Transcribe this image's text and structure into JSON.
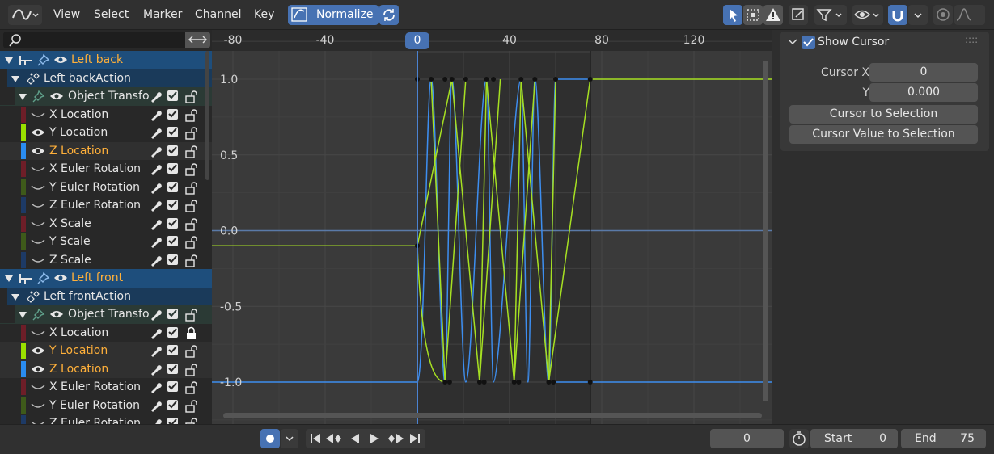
{
  "header": {
    "menus": [
      "View",
      "Select",
      "Marker",
      "Channel",
      "Key"
    ],
    "normalize_label": "Normalize"
  },
  "outliner": {
    "rows": [
      {
        "kind": "object",
        "label": "Left back"
      },
      {
        "kind": "action",
        "label": "Left backAction"
      },
      {
        "kind": "group",
        "label": "Object Transfor"
      },
      {
        "kind": "channel",
        "label": "X Location",
        "color": "#6e1e28",
        "eye": false,
        "lock": false
      },
      {
        "kind": "channel",
        "label": "Y Location",
        "color": "#9be000",
        "eye": true,
        "lock": false
      },
      {
        "kind": "channel",
        "label": "Z Location",
        "color": "#2a8cf0",
        "eye": true,
        "lock": false,
        "highlight": true
      },
      {
        "kind": "channel",
        "label": "X Euler Rotation",
        "color": "#6e1e28",
        "eye": false,
        "lock": false
      },
      {
        "kind": "channel",
        "label": "Y Euler Rotation",
        "color": "#3e5a1a",
        "eye": false,
        "lock": false
      },
      {
        "kind": "channel",
        "label": "Z Euler Rotation",
        "color": "#1d3a66",
        "eye": false,
        "lock": false
      },
      {
        "kind": "channel",
        "label": "X Scale",
        "color": "#6e1e28",
        "eye": false,
        "lock": false
      },
      {
        "kind": "channel",
        "label": "Y Scale",
        "color": "#3e5a1a",
        "eye": false,
        "lock": false
      },
      {
        "kind": "channel",
        "label": "Z Scale",
        "color": "#1d3a66",
        "eye": false,
        "lock": false
      },
      {
        "kind": "object",
        "label": "Left front"
      },
      {
        "kind": "action",
        "label": "Left frontAction"
      },
      {
        "kind": "group",
        "label": "Object Transfor"
      },
      {
        "kind": "channel",
        "label": "X Location",
        "color": "#6e1e28",
        "eye": false,
        "lock": true
      },
      {
        "kind": "channel",
        "label": "Y Location",
        "color": "#9be000",
        "eye": true,
        "lock": false,
        "highlight": true
      },
      {
        "kind": "channel",
        "label": "Z Location",
        "color": "#2a8cf0",
        "eye": true,
        "lock": false,
        "highlight": true
      },
      {
        "kind": "channel",
        "label": "X Euler Rotation",
        "color": "#6e1e28",
        "eye": false,
        "lock": false
      },
      {
        "kind": "channel",
        "label": "Y Euler Rotation",
        "color": "#3e5a1a",
        "eye": false,
        "lock": false
      },
      {
        "kind": "channel",
        "label": "Z Euler Rotation",
        "color": "#1d3a66",
        "eye": false,
        "lock": false
      }
    ]
  },
  "graph": {
    "x_ticks": [
      "-80",
      "-40",
      "0",
      "40",
      "80",
      "120"
    ],
    "y_ticks": [
      "1.0",
      "0.5",
      "0.0",
      "-0.5",
      "-1.0"
    ],
    "current_frame": "0"
  },
  "sidebar": {
    "show_cursor_label": "Show Cursor",
    "cursor_x_label": "Cursor X",
    "cursor_x_value": "0",
    "cursor_y_label": "Y",
    "cursor_y_value": "0.000",
    "cursor_to_selection": "Cursor to Selection",
    "cursor_value_to_selection": "Cursor Value to Selection"
  },
  "timeline": {
    "frame_value": "0",
    "start_label": "Start",
    "start_value": "0",
    "end_label": "End",
    "end_value": "75"
  }
}
